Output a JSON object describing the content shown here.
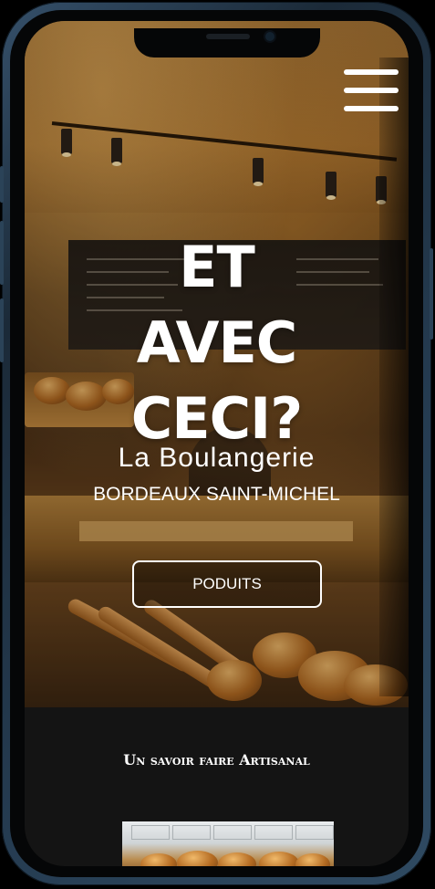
{
  "header": {
    "menu_icon": "hamburger-menu-icon"
  },
  "hero": {
    "title_line1": "ET",
    "title_line2": "AVEC",
    "title_line3": "CECI?",
    "subtitle": "La Boulangerie",
    "location": "BORDEAUX SAINT-MICHEL",
    "cta_label": "PODUITS"
  },
  "section": {
    "title": "Un savoir faire Artisanal"
  },
  "colors": {
    "text": "#ffffff",
    "section_bg": "#141414",
    "phone_frame": "#2a4055"
  }
}
